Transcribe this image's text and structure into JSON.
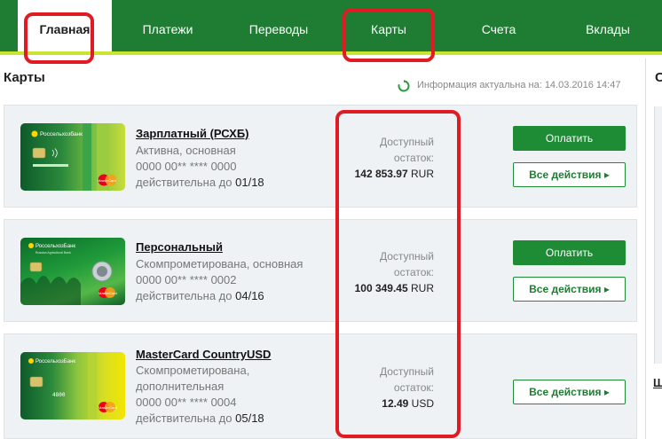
{
  "nav": {
    "items": [
      {
        "label": "Главная"
      },
      {
        "label": "Платежи"
      },
      {
        "label": "Переводы"
      },
      {
        "label": "Карты"
      },
      {
        "label": "Счета"
      },
      {
        "label": "Вклады"
      }
    ],
    "active_index": 0
  },
  "page": {
    "title": "Карты",
    "info": "Информация актуальна на: 14.03.2016 14:47",
    "side_title": "С",
    "side_link": "Ш"
  },
  "cards": [
    {
      "name": "Зарплатный (РСХБ)",
      "status": "Активна, основная",
      "number": "0000 00** **** 0000",
      "validity_prefix": "действительна до ",
      "validity": "01/18",
      "balance_label_1": "Доступный",
      "balance_label_2": "остаток:",
      "balance_amount": "142 853.97",
      "balance_currency": "RUR",
      "pay_label": "Оплатить",
      "actions_label": "Все действия",
      "card_bank_label": "Россельхозбанк",
      "card_brand": "MasterCard"
    },
    {
      "name": "Персональный",
      "status": "Скомпрометирована, основная",
      "number": "0000 00** **** 0002",
      "validity_prefix": "действительна до ",
      "validity": "04/16",
      "balance_label_1": "Доступный",
      "balance_label_2": "остаток:",
      "balance_amount": "100 349.45",
      "balance_currency": "RUR",
      "pay_label": "Оплатить",
      "actions_label": "Все действия",
      "card_bank_label": "РоссельхозБанк",
      "card_bank_sub": "Russian Agricultural Bank",
      "card_brand": "MasterCard"
    },
    {
      "name": "MasterCard CountryUSD",
      "status_1": "Скомпрометирована,",
      "status_2": "дополнительная",
      "number": "0000 00** **** 0004",
      "validity_prefix": "действительна до ",
      "validity": "05/18",
      "balance_label_1": "Доступный",
      "balance_label_2": "остаток:",
      "balance_amount": "12.49",
      "balance_currency": "USD",
      "actions_label": "Все действия",
      "card_bank_label": "РоссельхозБанк",
      "card_digits": "4800",
      "card_brand": "MasterCard"
    }
  ],
  "colors": {
    "nav_bg": "#1e7d32",
    "accent_lime": "#cde334",
    "pay_button": "#1e8c35",
    "highlight": "#e01b24",
    "row_bg": "#eef2f5"
  }
}
